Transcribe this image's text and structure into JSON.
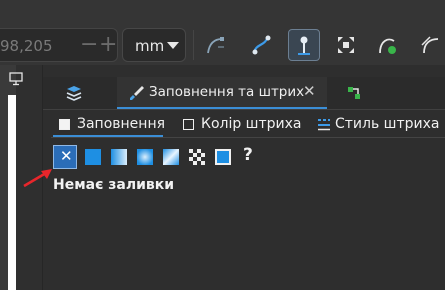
{
  "toolbar": {
    "coord_value": "98,205",
    "minus": "−",
    "plus": "+",
    "unit": "mm",
    "tools": [
      {
        "icon": "node-curve-cusp-icon"
      },
      {
        "icon": "node-make-curve-icon"
      },
      {
        "icon": "node-tweak-active-icon"
      },
      {
        "icon": "node-transform-icon"
      },
      {
        "icon": "path-effect-icon"
      },
      {
        "icon": "node-clip-icon"
      }
    ]
  },
  "dock": {
    "tabs": {
      "objects_icon": "layers-icon",
      "fill_label": "Заповнення та штрих",
      "fill_close": "✕",
      "xml_icon": "xml-editor-icon"
    },
    "subtabs": {
      "fill": "Заповнення",
      "stroke_paint": "Колір штриха",
      "stroke_style": "Стиль штриха"
    },
    "paint_buttons": [
      {
        "icon": "no-paint-icon",
        "glyph": "✕"
      },
      {
        "icon": "flat-color-icon"
      },
      {
        "icon": "linear-gradient-icon"
      },
      {
        "icon": "radial-gradient-icon"
      },
      {
        "icon": "mesh-gradient-icon"
      },
      {
        "icon": "pattern-icon"
      },
      {
        "icon": "swatch-icon"
      },
      {
        "icon": "unset-paint-icon",
        "glyph": "?"
      }
    ],
    "status": "Немає заливки"
  },
  "colors": {
    "accent": "#3b8ed6",
    "selected_bg": "#2b6db8",
    "flat_blue": "#1e8fe3",
    "arrow_red": "#e8262b"
  }
}
